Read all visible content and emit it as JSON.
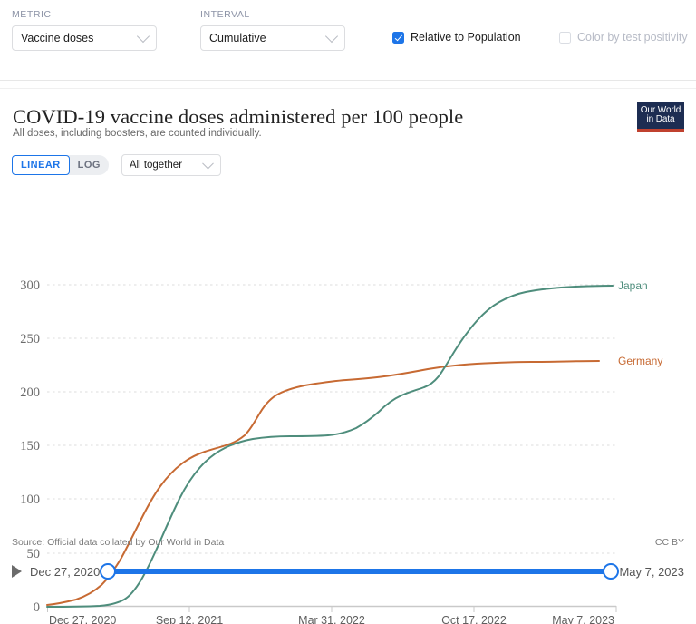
{
  "controls": {
    "metric": {
      "label": "METRIC",
      "value": "Vaccine doses",
      "icon": "chevron-down-icon"
    },
    "interval": {
      "label": "INTERVAL",
      "value": "Cumulative",
      "icon": "chevron-down-icon"
    },
    "relative_to_population": {
      "label": "Relative to Population",
      "checked": true
    },
    "color_by_test_positivity": {
      "label": "Color by test positivity",
      "checked": false
    }
  },
  "chart": {
    "title": "COVID-19 vaccine doses administered per 100 people",
    "subtitle": "All doses, including boosters, are counted individually.",
    "logo_line1": "Our World",
    "logo_line2": "in Data",
    "scale": {
      "linear": "LINEAR",
      "log": "LOG",
      "active": "LINEAR"
    },
    "facet": {
      "value": "All together",
      "icon": "chevron-down-icon"
    },
    "source": "Source: Official data collated by Our World in Data",
    "license": "CC BY"
  },
  "timeline": {
    "play_icon": "play-icon",
    "start": "Dec 27, 2020",
    "end": "May 7, 2023",
    "accent": "#1d75e8"
  },
  "chart_data": {
    "type": "line",
    "title": "COVID-19 vaccine doses administered per 100 people",
    "subtitle": "All doses, including boosters, are counted individually.",
    "xlabel": "",
    "ylabel": "",
    "ylim": [
      0,
      310
    ],
    "yticks": [
      0,
      50,
      100,
      150,
      200,
      250,
      300
    ],
    "xticks": [
      "Dec 27, 2020",
      "Sep 12, 2021",
      "Mar 31, 2022",
      "Oct 17, 2022",
      "May 7, 2023"
    ],
    "grid": true,
    "legend": "line-end-labels",
    "x_start": "Dec 27, 2020",
    "x_end": "May 7, 2023",
    "series": [
      {
        "name": "Japan",
        "color": "#4e8d7c",
        "end_value": 308,
        "x": [
          "Dec 27, 2020",
          "Feb 2021",
          "Apr 2021",
          "Jun 2021",
          "Jul 2021",
          "Aug 2021",
          "Sep 12, 2021",
          "Oct 2021",
          "Nov 2021",
          "Dec 2021",
          "Jan 2022",
          "Feb 2022",
          "Mar 31, 2022",
          "May 2022",
          "Jun 2022",
          "Aug 2022",
          "Sep 2022",
          "Oct 17, 2022",
          "Nov 2022",
          "Dec 2022",
          "Jan 2023",
          "Mar 2023",
          "May 7, 2023"
        ],
        "values": [
          0,
          0,
          1,
          13,
          45,
          78,
          110,
          132,
          145,
          152,
          158,
          160,
          163,
          172,
          185,
          205,
          225,
          248,
          268,
          285,
          298,
          306,
          308
        ]
      },
      {
        "name": "Germany",
        "color": "#c76a33",
        "end_value": 232,
        "x": [
          "Dec 27, 2020",
          "Feb 2021",
          "Apr 2021",
          "Jun 2021",
          "Jul 2021",
          "Aug 2021",
          "Sep 12, 2021",
          "Oct 2021",
          "Nov 2021",
          "Dec 2021",
          "Jan 2022",
          "Feb 2022",
          "Mar 31, 2022",
          "May 2022",
          "Jun 2022",
          "Aug 2022",
          "Sep 2022",
          "Oct 17, 2022",
          "Nov 2022",
          "Dec 2022",
          "Jan 2023",
          "Mar 2023",
          "May 7, 2023"
        ],
        "values": [
          0,
          6,
          25,
          63,
          85,
          103,
          118,
          128,
          134,
          142,
          170,
          188,
          200,
          207,
          212,
          216,
          219,
          221,
          224,
          228,
          230,
          231,
          232
        ]
      }
    ]
  }
}
